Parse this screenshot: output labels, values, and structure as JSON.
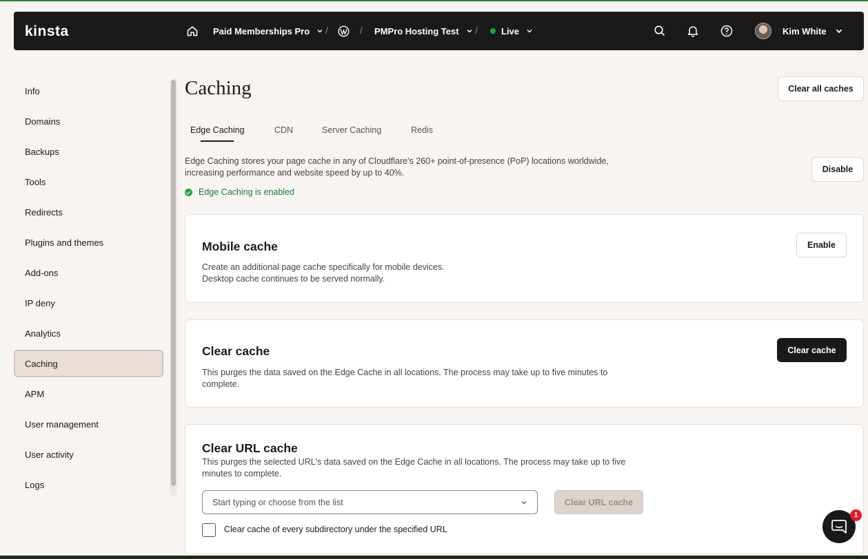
{
  "topbar": {
    "logo": "kinsta",
    "company": "Paid Memberships Pro",
    "site": "PMPro Hosting Test",
    "environment": "Live",
    "environment_color": "#1ea446",
    "user": "Kim White",
    "icons": [
      "home-icon",
      "wordpress-icon",
      "search-icon",
      "bell-icon",
      "help-icon"
    ]
  },
  "sidebar": {
    "items": [
      {
        "label": "Info"
      },
      {
        "label": "Domains"
      },
      {
        "label": "Backups"
      },
      {
        "label": "Tools"
      },
      {
        "label": "Redirects"
      },
      {
        "label": "Plugins and themes"
      },
      {
        "label": "Add-ons"
      },
      {
        "label": "IP deny"
      },
      {
        "label": "Analytics"
      },
      {
        "label": "Caching",
        "active": true
      },
      {
        "label": "APM"
      },
      {
        "label": "User management"
      },
      {
        "label": "User activity"
      },
      {
        "label": "Logs"
      }
    ]
  },
  "main": {
    "title": "Caching",
    "clear_all_label": "Clear all caches",
    "tabs": [
      {
        "label": "Edge Caching",
        "active": true
      },
      {
        "label": "CDN"
      },
      {
        "label": "Server Caching"
      },
      {
        "label": "Redis"
      }
    ],
    "description_line1": "Edge Caching stores your page cache in any of Cloudflare's 260+ point-of-presence (PoP) locations worldwide,",
    "description_line2": "increasing performance and website speed by up to 40%.",
    "disable_label": "Disable",
    "status": "Edge Caching is enabled",
    "status_color": "#1b7d37"
  },
  "mobile_cache": {
    "title": "Mobile cache",
    "line1": "Create an additional page cache specifically for mobile devices.",
    "line2": "Desktop cache continues to be served normally.",
    "button": "Enable"
  },
  "clear_cache": {
    "title": "Clear cache",
    "line1": "This purges the data saved on the Edge Cache in all locations. The process may take up to five minutes to",
    "line2": "complete.",
    "button": "Clear cache"
  },
  "clear_url_cache": {
    "title": "Clear URL cache",
    "line1": "This purges the selected URL's data saved on the Edge Cache in all locations. The process may take up to five",
    "line2": "minutes to complete.",
    "select_placeholder": "Start typing or choose from the list",
    "button": "Clear URL cache",
    "checkbox_label": "Clear cache of every subdirectory under the specified URL"
  },
  "chat": {
    "badge": "1"
  }
}
